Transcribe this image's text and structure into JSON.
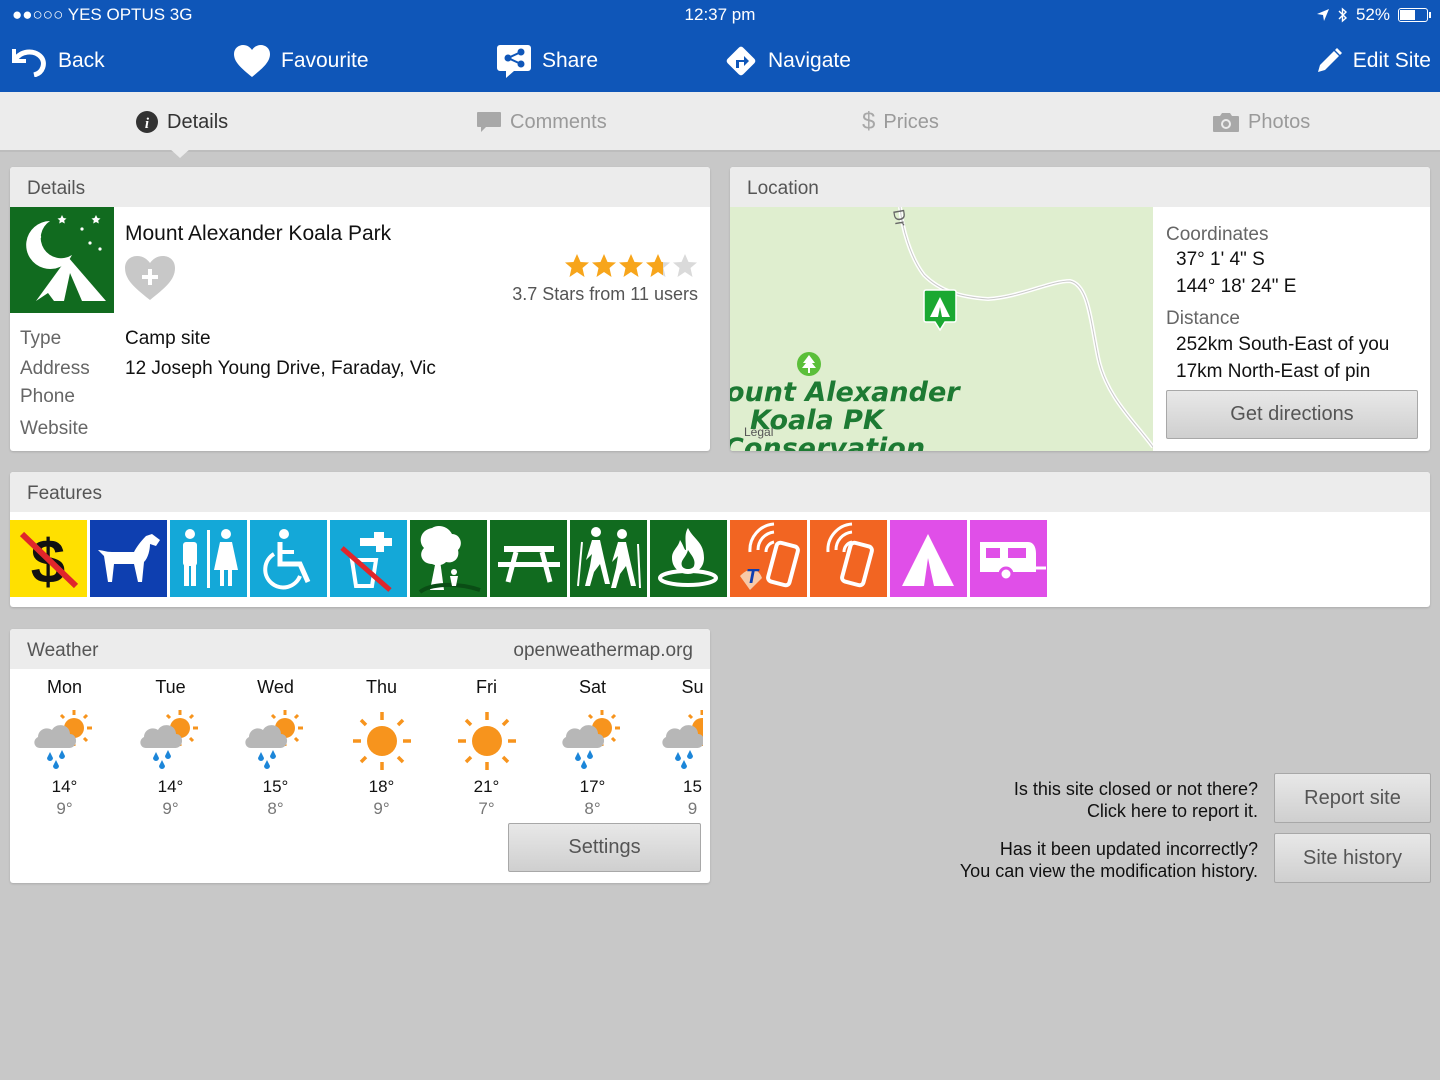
{
  "status_bar": {
    "carrier": "●●○○○ YES OPTUS   3G",
    "time": "12:37 pm",
    "battery": "52%"
  },
  "nav": {
    "back": "Back",
    "favourite": "Favourite",
    "share": "Share",
    "navigate": "Navigate",
    "edit_site": "Edit Site"
  },
  "tabs": [
    {
      "label": "Details",
      "icon": "info-icon",
      "active": true
    },
    {
      "label": "Comments",
      "icon": "comment-icon",
      "active": false
    },
    {
      "label": "Prices",
      "icon": "dollar-icon",
      "active": false
    },
    {
      "label": "Photos",
      "icon": "camera-icon",
      "active": false
    }
  ],
  "details": {
    "heading": "Details",
    "name": "Mount Alexander Koala Park",
    "rating_stars": 3.7,
    "rating_text": "3.7 Stars from 11 users",
    "type_label": "Type",
    "type_value": "Camp site",
    "address_label": "Address",
    "address_value": "12 Joseph Young Drive, Faraday, Vic",
    "phone_label": "Phone",
    "website_label": "Website"
  },
  "location": {
    "heading": "Location",
    "map_label_1": "ount Alexander",
    "map_label_2": "Koala PK",
    "map_label_3": "Conservation",
    "map_legal": "Legal",
    "coordinates_label": "Coordinates",
    "lat": "37° 1' 4\" S",
    "lon": "144° 18' 24\" E",
    "distance_label": "Distance",
    "distance_you": "252km South-East of you",
    "distance_pin": "17km North-East of pin",
    "directions_button": "Get directions"
  },
  "features": {
    "heading": "Features",
    "items": [
      {
        "name": "no-fee-icon",
        "color": "#ffe000"
      },
      {
        "name": "dog-icon",
        "color": "#0e3fb0"
      },
      {
        "name": "toilets-icon",
        "color": "#14a8d8"
      },
      {
        "name": "wheelchair-icon",
        "color": "#14a8d8"
      },
      {
        "name": "no-drinking-water-icon",
        "color": "#14a8d8"
      },
      {
        "name": "shade-tree-icon",
        "color": "#116b1f"
      },
      {
        "name": "picnic-table-icon",
        "color": "#116b1f"
      },
      {
        "name": "hiking-icon",
        "color": "#116b1f"
      },
      {
        "name": "fire-icon",
        "color": "#116b1f"
      },
      {
        "name": "telstra-reception-icon",
        "color": "#f26522"
      },
      {
        "name": "phone-reception-icon",
        "color": "#f26522"
      },
      {
        "name": "tent-icon",
        "color": "#e04fe8"
      },
      {
        "name": "caravan-icon",
        "color": "#e04fe8"
      }
    ]
  },
  "weather": {
    "heading": "Weather",
    "source": "openweathermap.org",
    "days": [
      {
        "day": "Mon",
        "hi": "14°",
        "lo": "9°",
        "icon": "rain-sun-icon"
      },
      {
        "day": "Tue",
        "hi": "14°",
        "lo": "9°",
        "icon": "rain-sun-icon"
      },
      {
        "day": "Wed",
        "hi": "15°",
        "lo": "8°",
        "icon": "rain-sun-icon"
      },
      {
        "day": "Thu",
        "hi": "18°",
        "lo": "9°",
        "icon": "sun-icon"
      },
      {
        "day": "Fri",
        "hi": "21°",
        "lo": "7°",
        "icon": "sun-icon"
      },
      {
        "day": "Sat",
        "hi": "17°",
        "lo": "8°",
        "icon": "rain-sun-icon"
      },
      {
        "day": "Su",
        "hi": "15",
        "lo": "9",
        "icon": "rain-sun-icon"
      }
    ],
    "settings_button": "Settings"
  },
  "report": {
    "closed_line1": "Is this site closed or not there?",
    "closed_line2": "Click here to report it.",
    "report_button": "Report site",
    "updated_line1": "Has it been updated incorrectly?",
    "updated_line2": "You can view the modification history.",
    "history_button": "Site history"
  }
}
